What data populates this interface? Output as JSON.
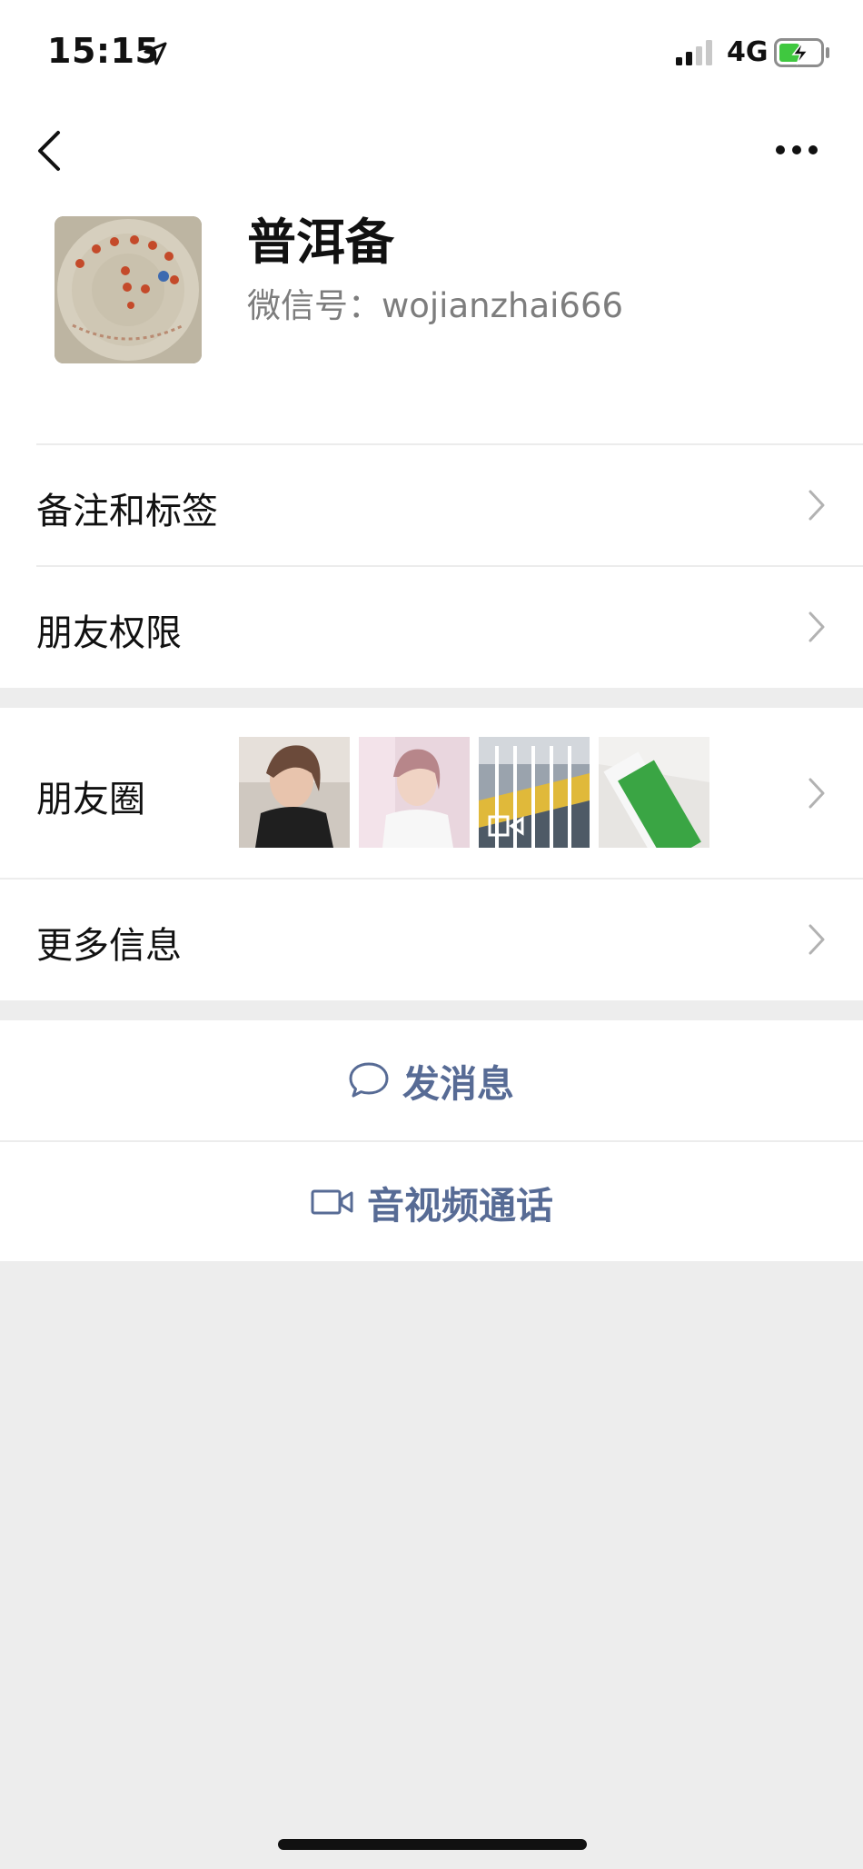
{
  "status_bar": {
    "time": "15:15",
    "network": "4G"
  },
  "profile": {
    "name": "普洱备",
    "wechat_id_label": "微信号：",
    "wechat_id_value": "wojianzhai666"
  },
  "rows": {
    "remarks_tags": "备注和标签",
    "friend_permissions": "朋友权限",
    "moments": "朋友圈",
    "more_info": "更多信息"
  },
  "actions": {
    "send_message": "发消息",
    "video_call": "音视频通话"
  },
  "colors": {
    "accent": "#576b95",
    "background": "#ededed",
    "card": "#ffffff",
    "secondary_text": "#7d7d7d",
    "battery_charge": "#3fc83f"
  },
  "icons": [
    "location-arrow-icon",
    "signal-icon",
    "battery-charging-icon",
    "back-icon",
    "more-icon",
    "chevron-right-icon",
    "chat-bubble-icon",
    "video-camera-icon",
    "video-play-icon"
  ]
}
